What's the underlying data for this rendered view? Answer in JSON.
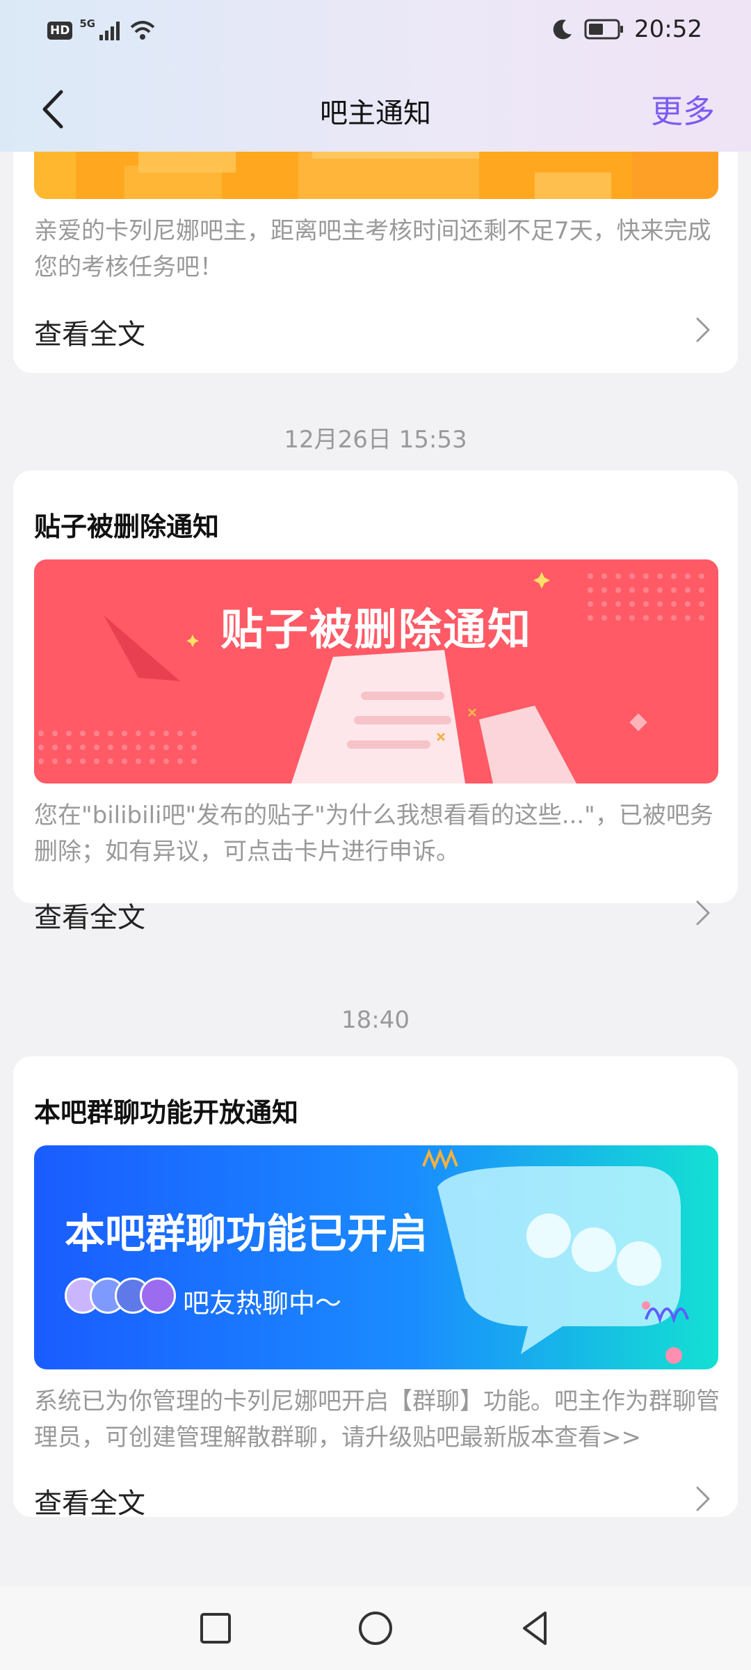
{
  "status_bar": {
    "hd": "HD",
    "network": "5G",
    "time": "20:52"
  },
  "header": {
    "title": "吧主通知",
    "more": "更多"
  },
  "notices": [
    {
      "title": "",
      "desc": "亲爱的卡列尼娜吧主，距离吧主考核时间还剩不足7天，快来完成您的考核任务吧！",
      "read_more": "查看全文"
    },
    {
      "time": "12月26日 15:53",
      "title": "贴子被删除通知",
      "banner_text": "贴子被删除通知",
      "desc": "您在\"bilibili吧\"发布的贴子\"为什么我想看看的这些...\"，已被吧务删除；如有异议，可点击卡片进行申诉。",
      "read_more": "查看全文"
    },
    {
      "time": "18:40",
      "title": "本吧群聊功能开放通知",
      "banner_text": "本吧群聊功能已开启",
      "banner_sub": "吧友热聊中～",
      "desc": "系统已为你管理的卡列尼娜吧开启【群聊】功能。吧主作为群聊管理员，可创建管理解散群聊，请升级贴吧最新版本查看>>",
      "read_more": "查看全文"
    }
  ],
  "colors": {
    "accent": "#7b5cf0",
    "delete_banner": "#ff5a66",
    "chat_banner_start": "#1a5cff",
    "chat_banner_end": "#13e0d2"
  }
}
